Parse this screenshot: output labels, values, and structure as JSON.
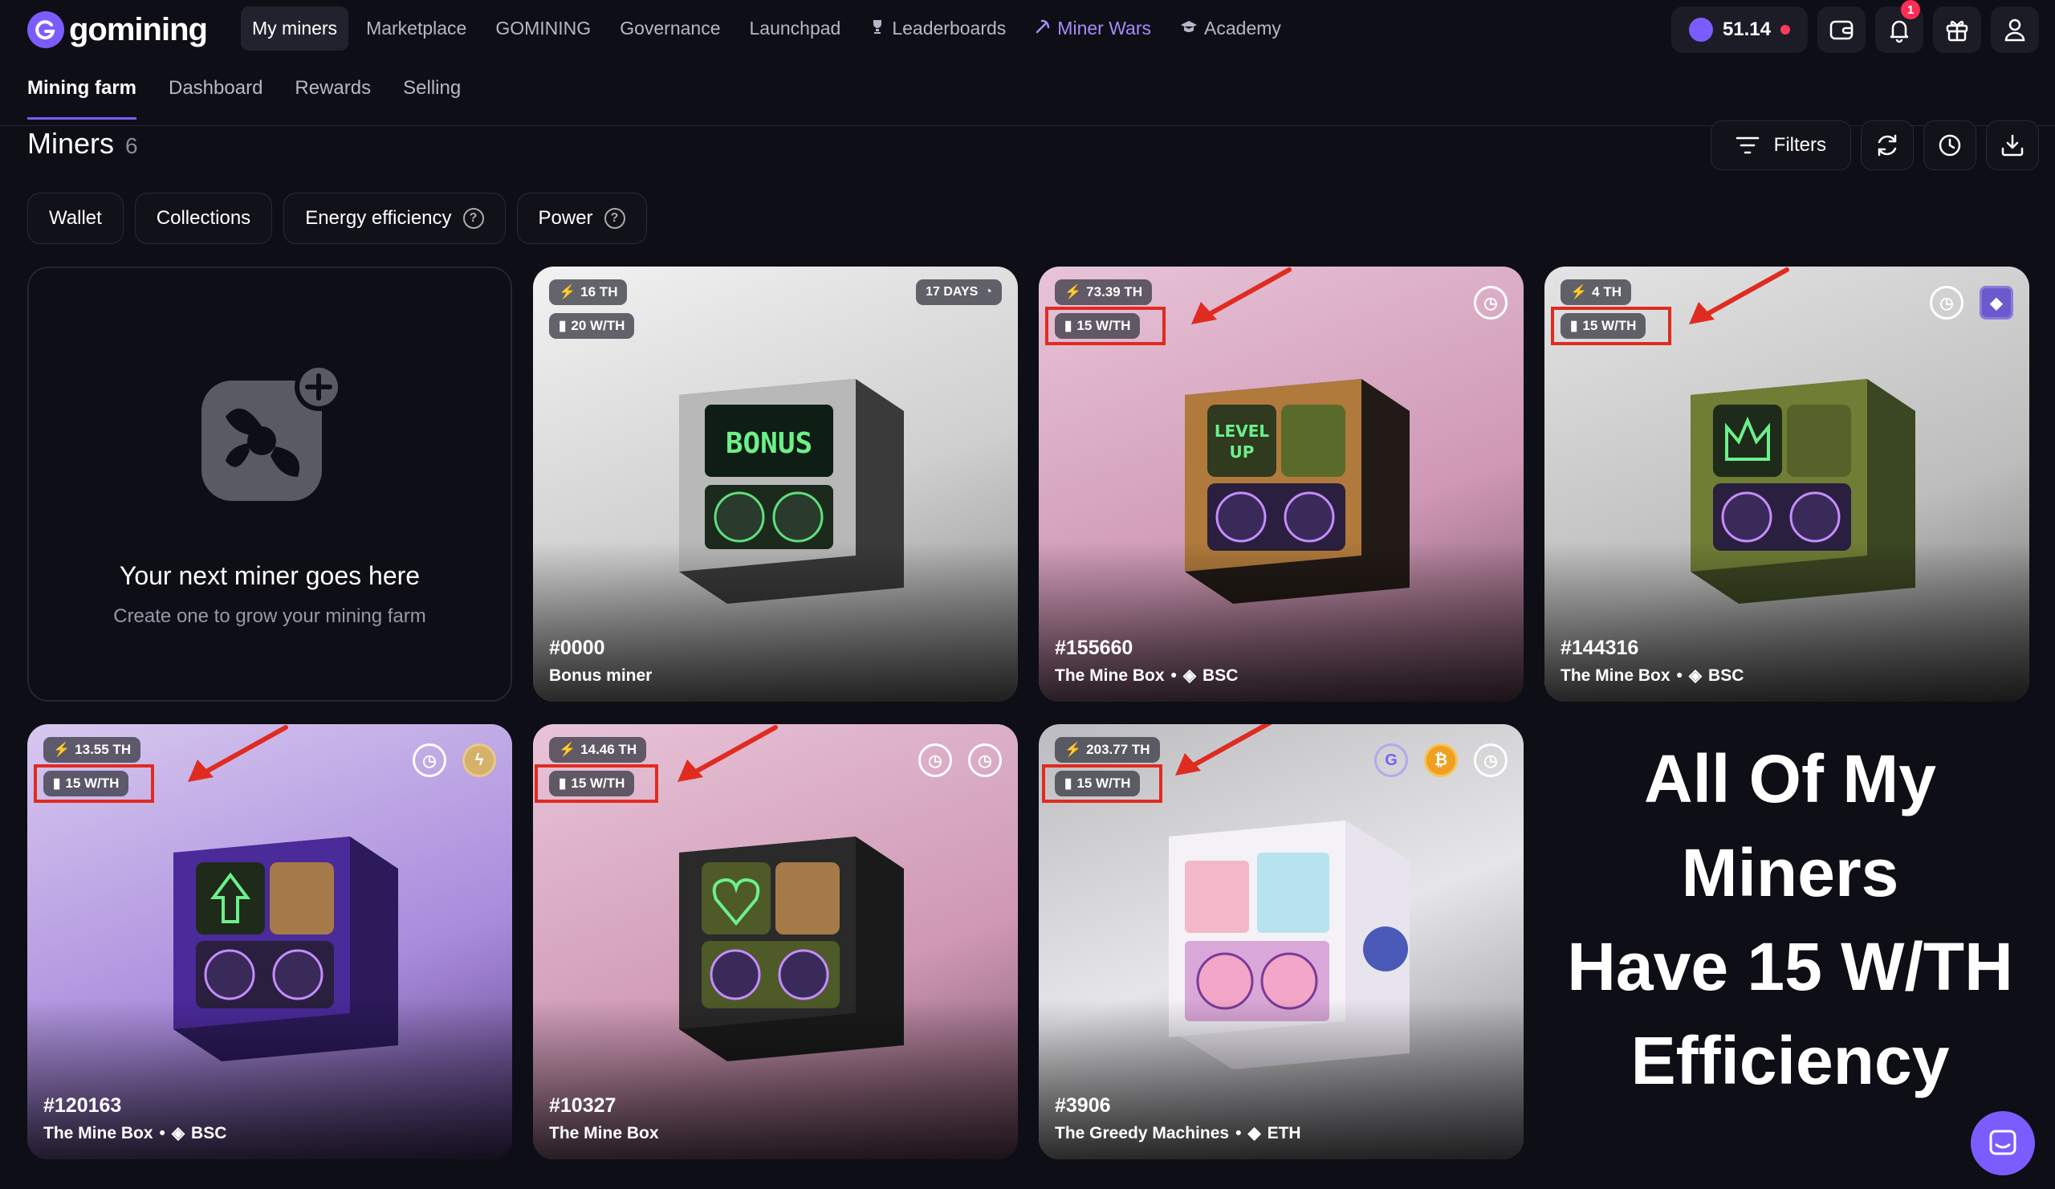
{
  "app": {
    "logo_text": "gomining"
  },
  "nav": {
    "items": [
      {
        "label": "My miners"
      },
      {
        "label": "Marketplace"
      },
      {
        "label": "GOMINING"
      },
      {
        "label": "Governance"
      },
      {
        "label": "Launchpad"
      },
      {
        "label": "Leaderboards"
      },
      {
        "label": "Miner Wars"
      },
      {
        "label": "Academy"
      }
    ],
    "balance": "51.14",
    "notification_count": "1"
  },
  "subnav": {
    "items": [
      {
        "label": "Mining farm"
      },
      {
        "label": "Dashboard"
      },
      {
        "label": "Rewards"
      },
      {
        "label": "Selling"
      }
    ]
  },
  "section": {
    "title": "Miners",
    "count": "6",
    "filters_label": "Filters"
  },
  "chips": [
    "Wallet",
    "Collections",
    "Energy efficiency",
    "Power"
  ],
  "empty_card": {
    "title": "Your next miner goes here",
    "subtitle": "Create one to grow your mining farm"
  },
  "miners": [
    {
      "th": "16 TH",
      "wth": "20 W/TH",
      "days": "17 DAYS",
      "id": "#0000",
      "collection": "Bonus miner",
      "chain": "",
      "screen": "BONUS"
    },
    {
      "th": "73.39 TH",
      "wth": "15 W/TH",
      "id": "#155660",
      "collection": "The Mine Box",
      "chain": "BSC",
      "screen": "LEVEL UP"
    },
    {
      "th": "4 TH",
      "wth": "15 W/TH",
      "id": "#144316",
      "collection": "The Mine Box",
      "chain": "BSC"
    },
    {
      "th": "13.55 TH",
      "wth": "15 W/TH",
      "id": "#120163",
      "collection": "The Mine Box",
      "chain": "BSC"
    },
    {
      "th": "14.46 TH",
      "wth": "15 W/TH",
      "id": "#10327",
      "collection": "The Mine Box",
      "chain": ""
    },
    {
      "th": "203.77 TH",
      "wth": "15 W/TH",
      "id": "#3906",
      "collection": "The Greedy Machines",
      "chain": "ETH"
    }
  ],
  "annotation": {
    "lines": [
      "All Of My",
      "Miners",
      "Have 15 W/TH",
      "Efficiency"
    ],
    "color": "#e02b20"
  }
}
